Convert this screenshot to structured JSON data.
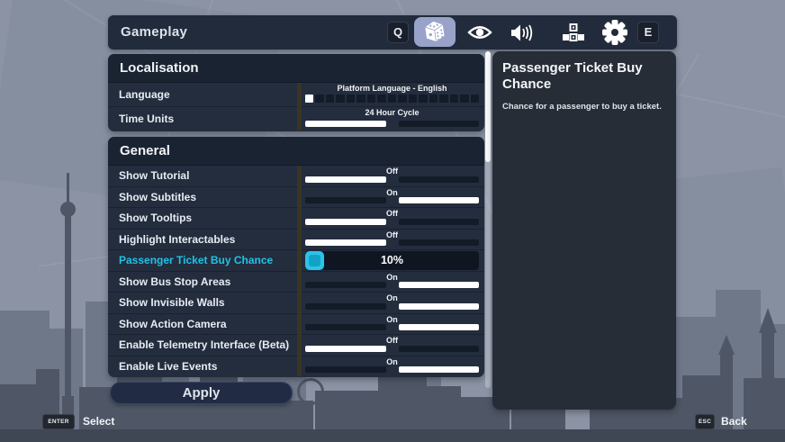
{
  "colors": {
    "accent": "#21c2e6",
    "active_tab_bg": "#99a3c9",
    "panel_bg": "#232d3e"
  },
  "top_bar": {
    "title": "Gameplay",
    "prev_key": "Q",
    "next_key": "E",
    "tabs": [
      {
        "icon": "dice-icon",
        "active": true
      },
      {
        "icon": "eye-icon",
        "active": false
      },
      {
        "icon": "speaker-icon",
        "active": false
      },
      {
        "icon": "blocks-icon",
        "active": false
      },
      {
        "icon": "gear-icon",
        "active": false
      }
    ]
  },
  "sections": [
    {
      "title": "Localisation",
      "rows": [
        {
          "label": "Language",
          "type": "segmented",
          "value": "Platform Language - English",
          "segments": 17,
          "selected_index": 0
        },
        {
          "label": "Time Units",
          "type": "toggle",
          "value": "24 Hour Cycle",
          "state": "left"
        }
      ]
    },
    {
      "title": "General",
      "rows": [
        {
          "label": "Show Tutorial",
          "type": "toggle",
          "value": "Off",
          "state": "left"
        },
        {
          "label": "Show Subtitles",
          "type": "toggle",
          "value": "On",
          "state": "right"
        },
        {
          "label": "Show Tooltips",
          "type": "toggle",
          "value": "Off",
          "state": "left"
        },
        {
          "label": "Highlight Interactables",
          "type": "toggle",
          "value": "Off",
          "state": "left"
        },
        {
          "label": "Passenger Ticket Buy Chance",
          "type": "slider",
          "value": "10%",
          "selected": true
        },
        {
          "label": "Show Bus Stop Areas",
          "type": "toggle",
          "value": "On",
          "state": "right"
        },
        {
          "label": "Show Invisible Walls",
          "type": "toggle",
          "value": "On",
          "state": "right"
        },
        {
          "label": "Show Action Camera",
          "type": "toggle",
          "value": "On",
          "state": "right"
        },
        {
          "label": "Enable Telemetry Interface (Beta)",
          "type": "toggle",
          "value": "Off",
          "state": "left"
        },
        {
          "label": "Enable Live Events",
          "type": "toggle",
          "value": "On",
          "state": "right"
        }
      ]
    }
  ],
  "detail_panel": {
    "title": "Passenger Ticket Buy Chance",
    "description": "Chance for a passenger to buy a ticket."
  },
  "apply_button": {
    "label": "Apply"
  },
  "footer": {
    "select_key": "ENTER",
    "select_label": "Select",
    "back_key": "ESC",
    "back_label": "Back"
  }
}
